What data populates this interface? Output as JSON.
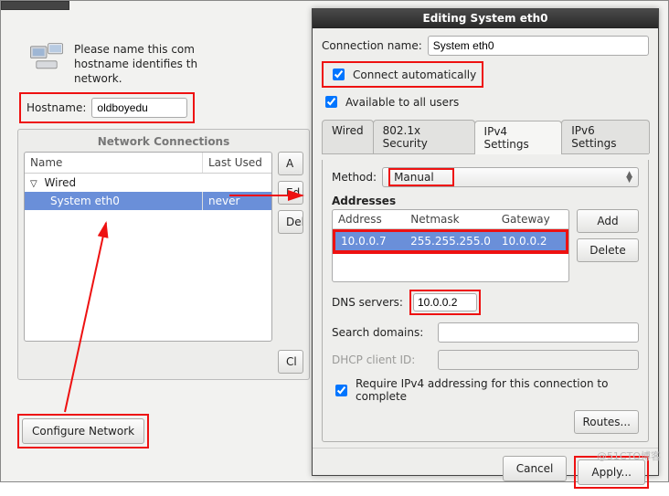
{
  "intro": {
    "line1": "Please name this com",
    "line2": "hostname identifies th",
    "line3": "network."
  },
  "hostname": {
    "label": "Hostname:",
    "value": "oldboyedu"
  },
  "netconn": {
    "title": "Network Connections",
    "col_name": "Name",
    "col_used": "Last Used",
    "group_wired": "Wired",
    "item_label": "System eth0",
    "item_used": "never",
    "btn_add": "A",
    "btn_edit": "Ed",
    "btn_delete": "Dele",
    "btn_close": "Cl"
  },
  "config_network_btn": "Configure Network",
  "editdlg": {
    "title": "Editing System eth0",
    "conn_name_label": "Connection name:",
    "conn_name_value": "System eth0",
    "connect_auto": "Connect automatically",
    "avail_all": "Available to all users",
    "tabs": {
      "wired": "Wired",
      "dot1x": "802.1x Security",
      "ipv4": "IPv4 Settings",
      "ipv6": "IPv6 Settings"
    },
    "method_label": "Method:",
    "method_value": "Manual",
    "addresses_header": "Addresses",
    "addr_cols": {
      "address": "Address",
      "netmask": "Netmask",
      "gateway": "Gateway"
    },
    "addr_row": {
      "address": "10.0.0.7",
      "netmask": "255.255.255.0",
      "gateway": "10.0.0.2"
    },
    "btn_add": "Add",
    "btn_delete": "Delete",
    "dns_label": "DNS servers:",
    "dns_value": "10.0.0.2",
    "search_label": "Search domains:",
    "search_value": "",
    "dhcp_label": "DHCP client ID:",
    "dhcp_value": "",
    "require_ipv4": "Require IPv4 addressing for this connection to complete",
    "routes_btn": "Routes...",
    "cancel_btn": "Cancel",
    "apply_btn": "Apply..."
  },
  "watermark": "@51CTO博客"
}
